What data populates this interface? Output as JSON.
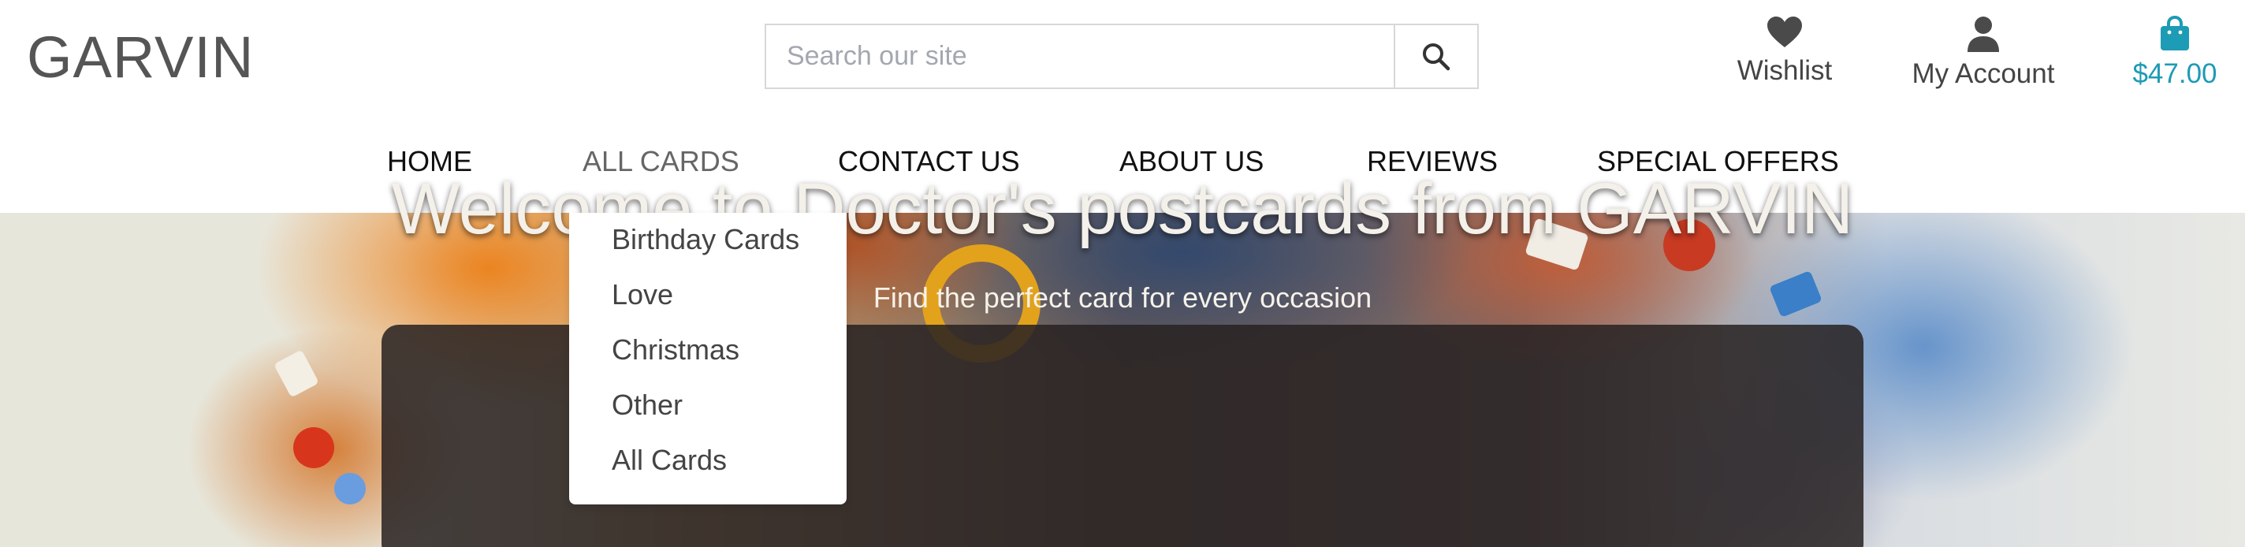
{
  "header": {
    "logo": "GARVIN",
    "search": {
      "placeholder": "Search our site",
      "button_icon": "search-icon"
    },
    "links": [
      {
        "label": "Wishlist",
        "icon": "heart-icon"
      },
      {
        "label": "My Account",
        "icon": "user-icon"
      },
      {
        "label": "$47.00",
        "icon": "shopping-bag-icon"
      }
    ]
  },
  "nav": {
    "items": [
      {
        "label": "HOME"
      },
      {
        "label": "ALL CARDS",
        "active": true
      },
      {
        "label": "CONTACT US"
      },
      {
        "label": "ABOUT US"
      },
      {
        "label": "REVIEWS"
      },
      {
        "label": "SPECIAL OFFERS"
      }
    ]
  },
  "dropdown": {
    "items": [
      {
        "label": "Birthday Cards"
      },
      {
        "label": "Love"
      },
      {
        "label": "Christmas"
      },
      {
        "label": "Other"
      },
      {
        "label": "All Cards"
      }
    ]
  },
  "hero": {
    "title": "Welcome to Doctor's postcards from GARVIN",
    "subtitle": "Find the perfect card for every occasion"
  },
  "colors": {
    "accent": "#1e9bb5",
    "text": "#444444",
    "logo": "#555555"
  }
}
